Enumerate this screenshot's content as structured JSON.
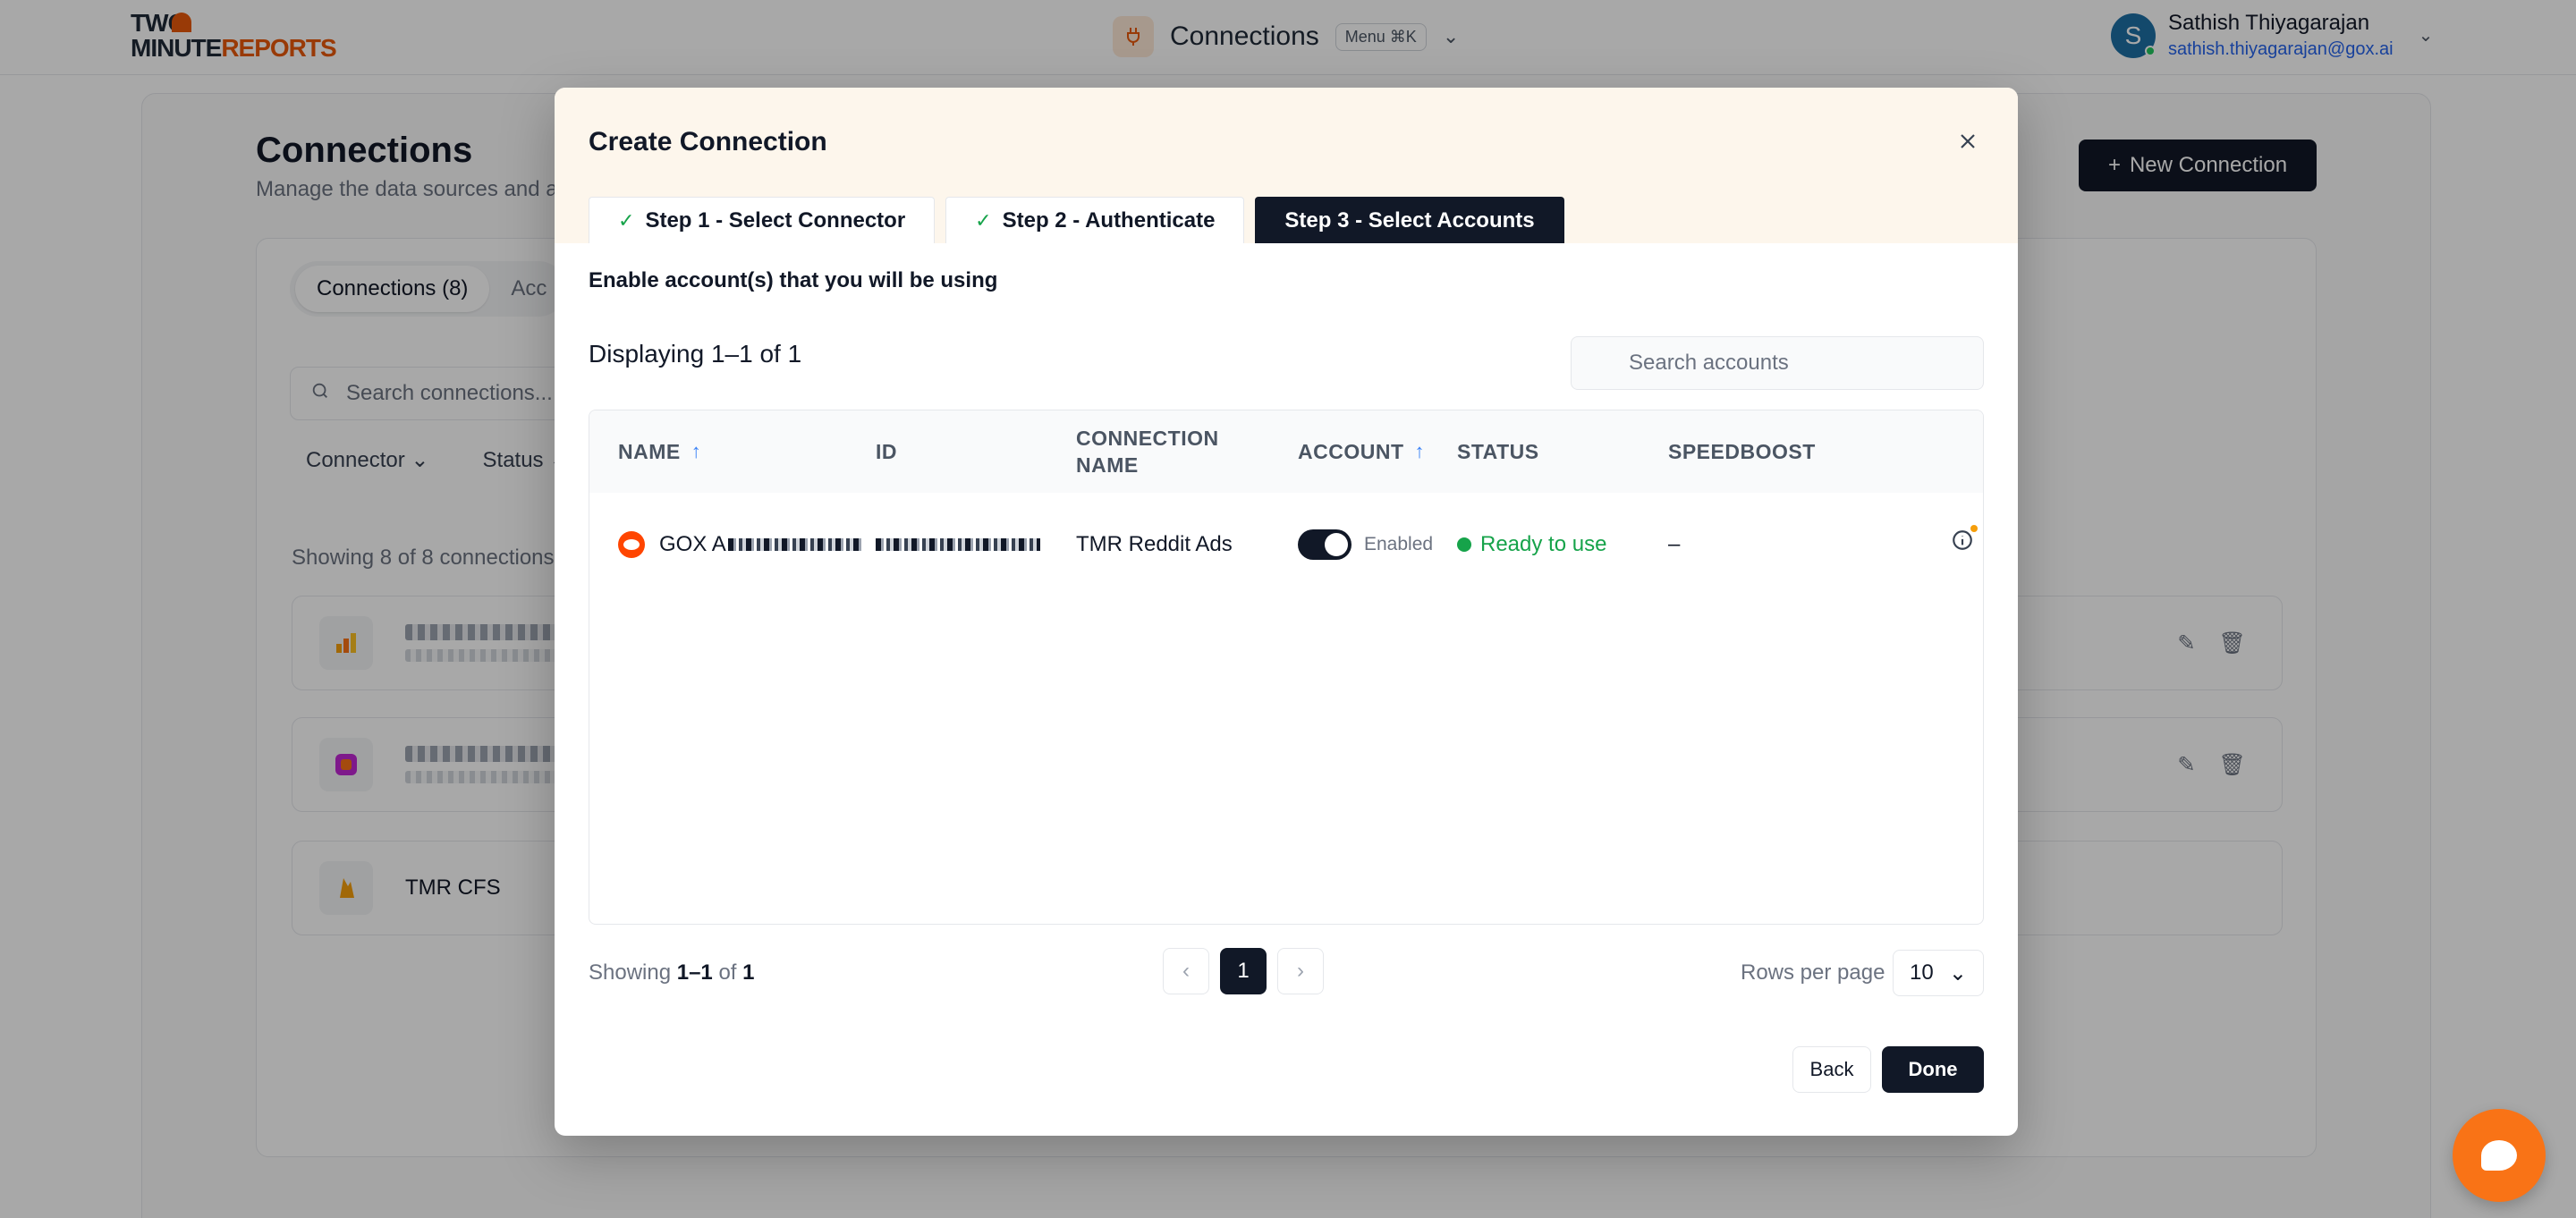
{
  "app": {
    "logo_line1": "TWO",
    "logo_line2a": "MINUTE",
    "logo_line2b": "REPORTS",
    "title": "Connections",
    "menu_chip": "Menu ⌘K"
  },
  "user": {
    "initial": "S",
    "name": "Sathish Thiyagarajan",
    "email": "sathish.thiyagarajan@gox.ai"
  },
  "page": {
    "title": "Connections",
    "subtitle": "Manage the data sources and ac",
    "new_connection_label": "New Connection",
    "tabs": [
      {
        "label": "Connections (8)"
      },
      {
        "label": "Acc"
      }
    ],
    "search_placeholder": "Search connections...",
    "filters": [
      "Connector",
      "Status"
    ],
    "showing": "Showing 8 of 8 connections",
    "items": [
      {
        "name": ""
      },
      {
        "name": "In"
      },
      {
        "name": "TMR CFS"
      }
    ]
  },
  "modal": {
    "title": "Create Connection",
    "steps": [
      {
        "label": "Step 1 - Select Connector",
        "done": true
      },
      {
        "label": "Step 2 - Authenticate",
        "done": true
      },
      {
        "label": "Step 3 - Select Accounts",
        "done": false
      }
    ],
    "enable_text": "Enable account(s) that you will be using",
    "displaying": "Displaying 1–1 of 1",
    "search_placeholder": "Search accounts",
    "columns": {
      "name": "NAME",
      "id": "ID",
      "connection_name": "CONNECTION NAME",
      "account": "ACCOUNT",
      "status": "STATUS",
      "speedboost": "SPEEDBOOST"
    },
    "row": {
      "name_prefix": "GOX A",
      "connection_name": "TMR Reddit Ads",
      "toggle_label": "Enabled",
      "status": "Ready to use",
      "speedboost": "–"
    },
    "footer": {
      "showing_prefix": "Showing ",
      "showing_range": "1–1",
      "showing_mid": " of ",
      "showing_total": "1",
      "current_page": "1",
      "rows_per_page_label": "Rows per page",
      "rows_per_page": "10"
    },
    "back_label": "Back",
    "done_label": "Done"
  },
  "colors": {
    "accent_dark": "#111827",
    "brand_orange": "#e8590c",
    "success": "#16a34a",
    "header_tint": "#fdf6ec"
  }
}
